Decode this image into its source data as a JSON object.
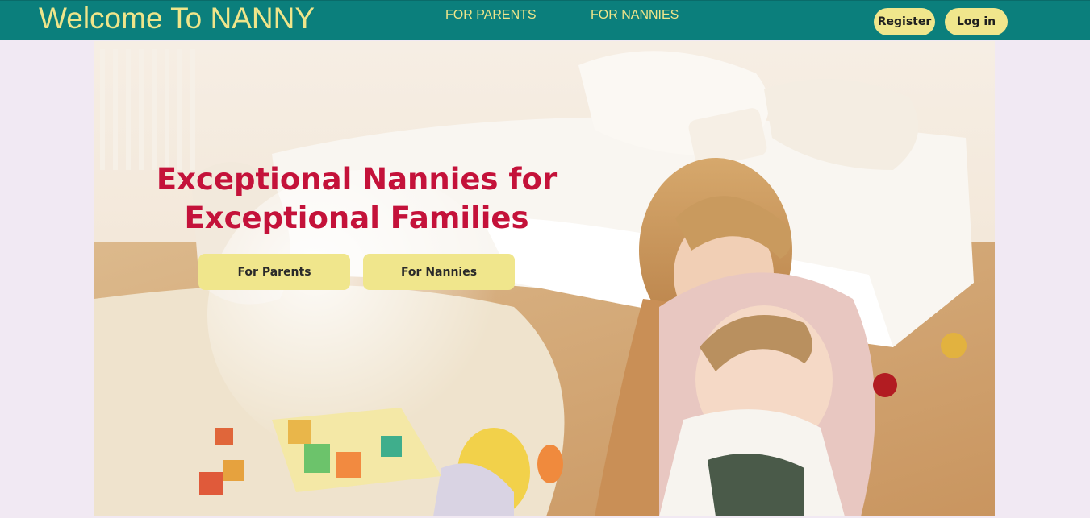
{
  "header": {
    "brand": "Welcome To NANNY",
    "nav": [
      {
        "label": "FOR PARENTS"
      },
      {
        "label": "FOR NANNIES"
      }
    ],
    "register_label": "Register",
    "login_label": "Log in"
  },
  "hero": {
    "headline_line1": "Exceptional Nannies for",
    "headline_line2": "Exceptional Families",
    "buttons": [
      {
        "label": "For Parents"
      },
      {
        "label": "For Nannies"
      }
    ]
  },
  "colors": {
    "header_bg": "#0b7f7c",
    "brand_text": "#efe58a",
    "accent_button": "#f0e68c",
    "headline": "#c4123a",
    "page_bg": "#f1e9f3"
  }
}
